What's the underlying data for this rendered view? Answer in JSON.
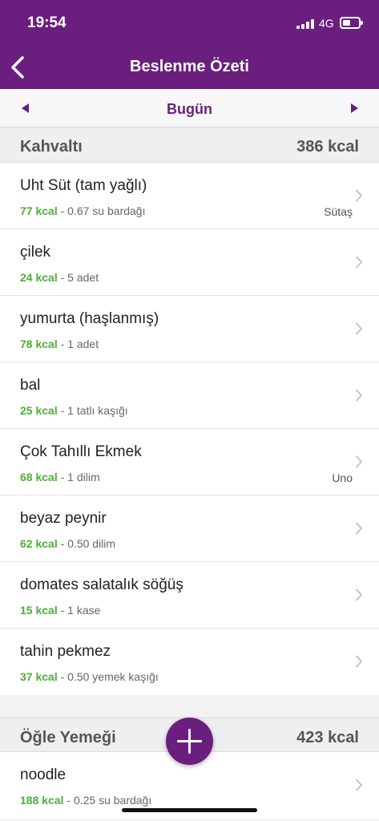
{
  "status": {
    "time": "19:54",
    "network": "4G"
  },
  "nav": {
    "title": "Beslenme Özeti"
  },
  "date": {
    "label": "Bugün"
  },
  "sections": [
    {
      "name": "Kahvaltı",
      "kcal": "386 kcal",
      "items": [
        {
          "name": "Uht Süt (tam yağlı)",
          "kcal": "77 kcal",
          "portion": " - 0.67 su bardağı",
          "brand": "Sütaş"
        },
        {
          "name": "çilek",
          "kcal": "24 kcal",
          "portion": " - 5 adet",
          "brand": ""
        },
        {
          "name": "yumurta (haşlanmış)",
          "kcal": "78 kcal",
          "portion": " - 1 adet",
          "brand": ""
        },
        {
          "name": "bal",
          "kcal": "25 kcal",
          "portion": " - 1 tatlı kaşığı",
          "brand": ""
        },
        {
          "name": "Çok Tahıllı Ekmek",
          "kcal": "68 kcal",
          "portion": " - 1 dilim",
          "brand": "Uno"
        },
        {
          "name": "beyaz peynir",
          "kcal": "62 kcal",
          "portion": " - 0.50 dilim",
          "brand": ""
        },
        {
          "name": "domates salatalık söğüş",
          "kcal": "15 kcal",
          "portion": " - 1 kase",
          "brand": ""
        },
        {
          "name": "tahin pekmez",
          "kcal": "37 kcal",
          "portion": " - 0.50 yemek kaşığı",
          "brand": ""
        }
      ]
    },
    {
      "name": "Öğle Yemeği",
      "kcal": "423 kcal",
      "items": [
        {
          "name": "noodle",
          "kcal": "188 kcal",
          "portion": " - 0.25 su bardağı",
          "brand": ""
        }
      ]
    }
  ],
  "colors": {
    "primary": "#6a1f7e",
    "kcal_green": "#4caf3a"
  },
  "icons": {
    "back": "chevron-left-icon",
    "prev": "triangle-left-icon",
    "next": "triangle-right-icon",
    "add": "plus-icon",
    "row": "chevron-right-icon"
  }
}
